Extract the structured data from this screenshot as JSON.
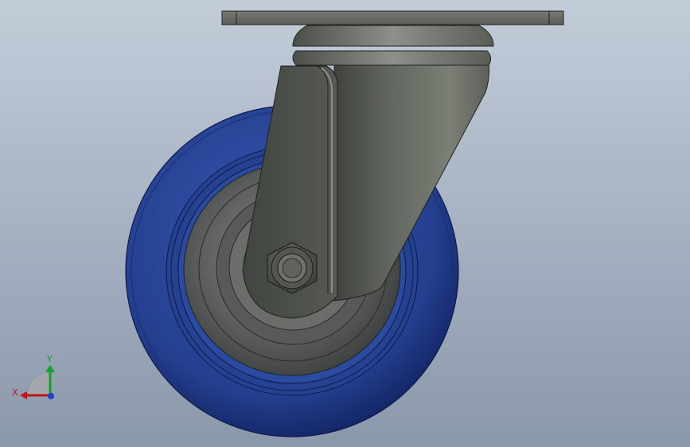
{
  "viewport": {
    "background_top": "#c3ccd9",
    "background_bottom": "#8a98ab"
  },
  "model": {
    "wheel_tread_color": "#2a4592",
    "wheel_hub_color": "#5e615f",
    "bracket_color": "#5a5e57",
    "top_plate_color": "#6b6f68"
  },
  "triad": {
    "x_label": "X",
    "y_label": "Y",
    "x_color": "#c0141c",
    "y_color": "#12a12a",
    "z_color": "#1d3ecf"
  }
}
